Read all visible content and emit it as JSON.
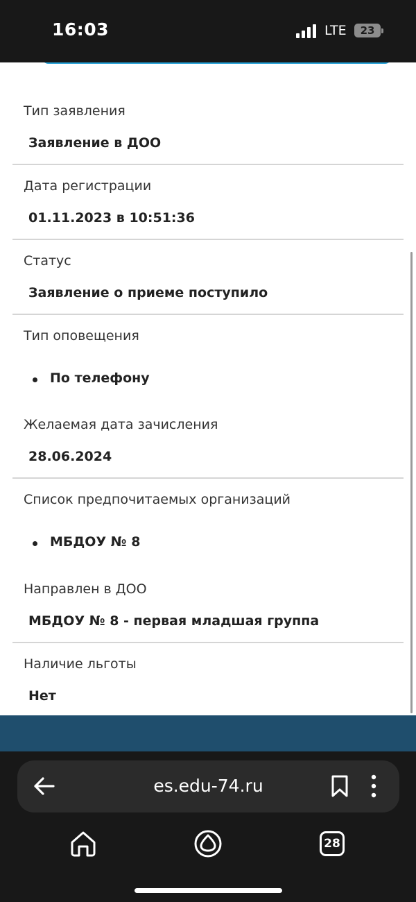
{
  "status_bar": {
    "time": "16:03",
    "network": "LTE",
    "battery": "23"
  },
  "fields": [
    {
      "label": "Тип заявления",
      "value": "Заявление в ДОО"
    },
    {
      "label": "Дата регистрации",
      "value": "01.11.2023 в 10:51:36"
    },
    {
      "label": "Статус",
      "value": "Заявление о приеме поступило"
    },
    {
      "label": "Тип оповещения",
      "value": "По телефону"
    },
    {
      "label": "Желаемая дата зачисления",
      "value": "28.06.2024"
    },
    {
      "label": "Список предпочитаемых организаций",
      "value": "МБДОУ № 8"
    },
    {
      "label": "Направлен в ДОО",
      "value": "МБДОУ № 8 - первая младшая группа"
    },
    {
      "label": "Наличие льготы",
      "value": "Нет"
    }
  ],
  "browser": {
    "url": "es.edu-74.ru",
    "tabs_count": "28"
  },
  "colors": {
    "accent": "#2aa3d8",
    "footer": "#1f4e6d",
    "chrome": "#181818"
  }
}
